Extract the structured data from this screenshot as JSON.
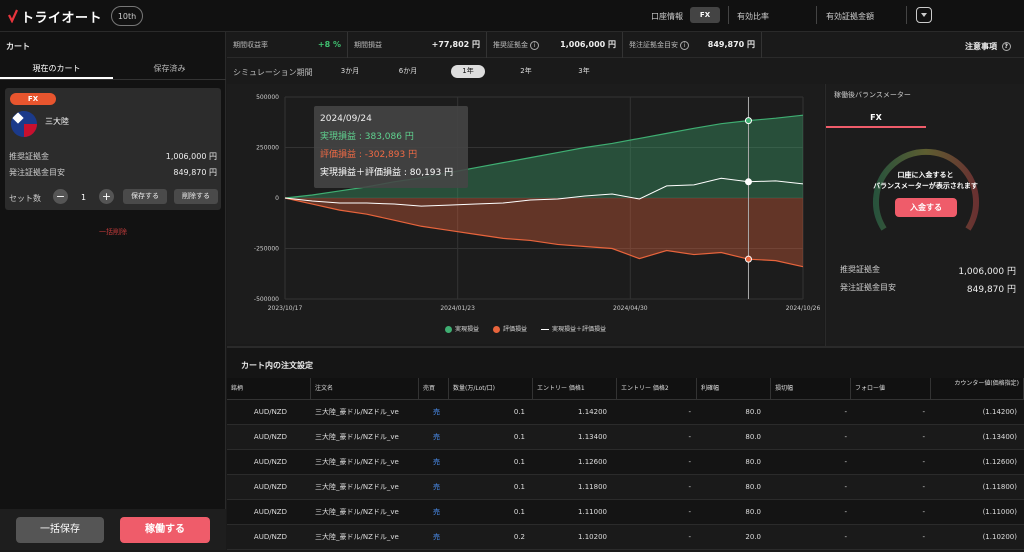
{
  "app": {
    "logo_text": "トライオート",
    "anniversary": "10th"
  },
  "topbar": {
    "account_info": "口座情報",
    "fx_button": "FX",
    "effective_ratio": "有効比率",
    "effective_margin": "有効証拠金額"
  },
  "left": {
    "title": "カート",
    "tabs": [
      "現在のカート",
      "保存済み"
    ],
    "card": {
      "badge": "FX",
      "name": "三大陸",
      "rows": [
        {
          "label": "推奨証拠金",
          "value": "1,006,000 円"
        },
        {
          "label": "発注証拠金目安",
          "value": "849,870 円"
        }
      ],
      "set_label": "セット数",
      "set_count": "1",
      "minus": "−",
      "plus": "+",
      "save_button": "保存する",
      "delete_button": "削除する"
    },
    "delete_all": "一括削除",
    "save_all": "一括保存",
    "run": "稼働する"
  },
  "stats": {
    "items": [
      {
        "label": "期間収益率",
        "value": "+8 %",
        "color": "#3fbf6f"
      },
      {
        "label": "期間損益",
        "value": "+77,802 円"
      },
      {
        "label": "推奨証拠金",
        "value": "1,006,000 円"
      },
      {
        "label": "発注証拠金目安",
        "value": "849,870 円"
      }
    ],
    "notes": "注意事項"
  },
  "period": {
    "label": "シミュレーション期間",
    "options": [
      "3か月",
      "6か月",
      "1年",
      "2年",
      "3年"
    ],
    "selected": "1年"
  },
  "chart_data": {
    "type": "area",
    "x_ticks": [
      "2023/10/17",
      "2024/01/23",
      "2024/04/30",
      "2024/10/26"
    ],
    "y_ticks": [
      "500000",
      "250000",
      "0",
      "-250000",
      "-500000"
    ],
    "ylim": [
      -500000,
      500000
    ],
    "series": [
      {
        "name": "実現損益",
        "color": "#3fae72",
        "values": [
          0,
          15000,
          35000,
          55000,
          80000,
          100000,
          125000,
          150000,
          175000,
          200000,
          225000,
          250000,
          270000,
          295000,
          320000,
          345000,
          368000,
          383086,
          395000,
          410000
        ]
      },
      {
        "name": "評価損益",
        "color": "#e8643c",
        "values": [
          0,
          -30000,
          -60000,
          -80000,
          -110000,
          -140000,
          -160000,
          -180000,
          -200000,
          -210000,
          -230000,
          -240000,
          -250000,
          -300000,
          -260000,
          -280000,
          -270000,
          -302893,
          -310000,
          -340000
        ]
      },
      {
        "name": "実現損益＋評価損益",
        "color": "#ffffff",
        "values": [
          0,
          -15000,
          -25000,
          -25000,
          -30000,
          -40000,
          -35000,
          -30000,
          -25000,
          -10000,
          -5000,
          10000,
          20000,
          -5000,
          60000,
          65000,
          98000,
          80193,
          85000,
          70000
        ]
      }
    ],
    "tooltip": {
      "date": "2024/09/24",
      "realized": "実現損益 : 383,086 円",
      "unrealized": "評価損益 : -302,893 円",
      "total": "実現損益＋評価損益 : 80,193 円"
    },
    "legend": [
      "実現損益",
      "評価損益",
      "実現損益＋評価損益"
    ]
  },
  "right": {
    "title": "稼働後バランスメーター",
    "tab": "FX",
    "message_1": "口座に入金すると",
    "message_2": "バランスメーターが表示されます",
    "deposit": "入金する",
    "rows": [
      {
        "label": "推奨証拠金",
        "value": "1,006,000 円"
      },
      {
        "label": "発注証拠金目安",
        "value": "849,870 円"
      }
    ]
  },
  "orders": {
    "title": "カート内の注文設定",
    "headers": [
      "銘柄",
      "注文名",
      "売買",
      "数量(万/Lot/口)",
      "エントリー 価格1",
      "エントリー 価格2",
      "利確幅",
      "損切幅",
      "フォロー値",
      "カウンター値(価格指定)"
    ],
    "rows": [
      [
        "AUD/NZD",
        "三大陸_豪ドル/NZドル_ve",
        "売",
        "0.1",
        "1.14200",
        "-",
        "80.0",
        "-",
        "-",
        "(1.14200)"
      ],
      [
        "AUD/NZD",
        "三大陸_豪ドル/NZドル_ve",
        "売",
        "0.1",
        "1.13400",
        "-",
        "80.0",
        "-",
        "-",
        "(1.13400)"
      ],
      [
        "AUD/NZD",
        "三大陸_豪ドル/NZドル_ve",
        "売",
        "0.1",
        "1.12600",
        "-",
        "80.0",
        "-",
        "-",
        "(1.12600)"
      ],
      [
        "AUD/NZD",
        "三大陸_豪ドル/NZドル_ve",
        "売",
        "0.1",
        "1.11800",
        "-",
        "80.0",
        "-",
        "-",
        "(1.11800)"
      ],
      [
        "AUD/NZD",
        "三大陸_豪ドル/NZドル_ve",
        "売",
        "0.1",
        "1.11000",
        "-",
        "80.0",
        "-",
        "-",
        "(1.11000)"
      ],
      [
        "AUD/NZD",
        "三大陸_豪ドル/NZドル_ve",
        "売",
        "0.2",
        "1.10200",
        "-",
        "20.0",
        "-",
        "-",
        "(1.10200)"
      ]
    ]
  }
}
